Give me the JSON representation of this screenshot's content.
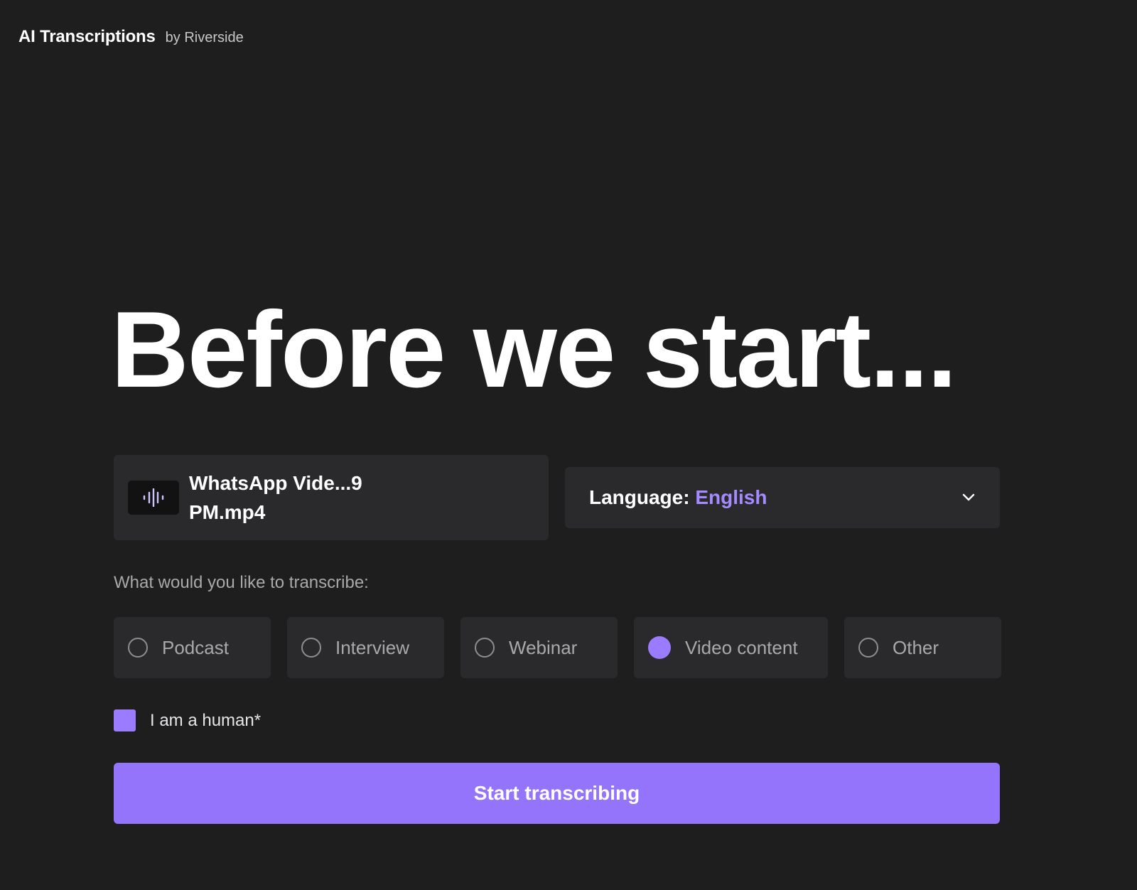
{
  "brand": {
    "title": "AI Transcriptions",
    "subtitle": "by Riverside"
  },
  "headline": "Before we start...",
  "file": {
    "name": "WhatsApp Vide...9 PM.mp4",
    "icon": "audio-waveform-icon"
  },
  "language": {
    "label": "Language:",
    "value": "English"
  },
  "question": "What would you like to transcribe:",
  "options": [
    {
      "label": "Podcast",
      "selected": false
    },
    {
      "label": "Interview",
      "selected": false
    },
    {
      "label": "Webinar",
      "selected": false
    },
    {
      "label": "Video content",
      "selected": true
    },
    {
      "label": "Other",
      "selected": false
    }
  ],
  "human_check": {
    "label": "I am a human*",
    "checked": true
  },
  "start_button": "Start transcribing",
  "colors": {
    "background": "#1e1e1f",
    "card": "#2a2a2c",
    "accent": "#9b7bff",
    "accent_text": "#a58bff",
    "button": "#9474fb"
  }
}
